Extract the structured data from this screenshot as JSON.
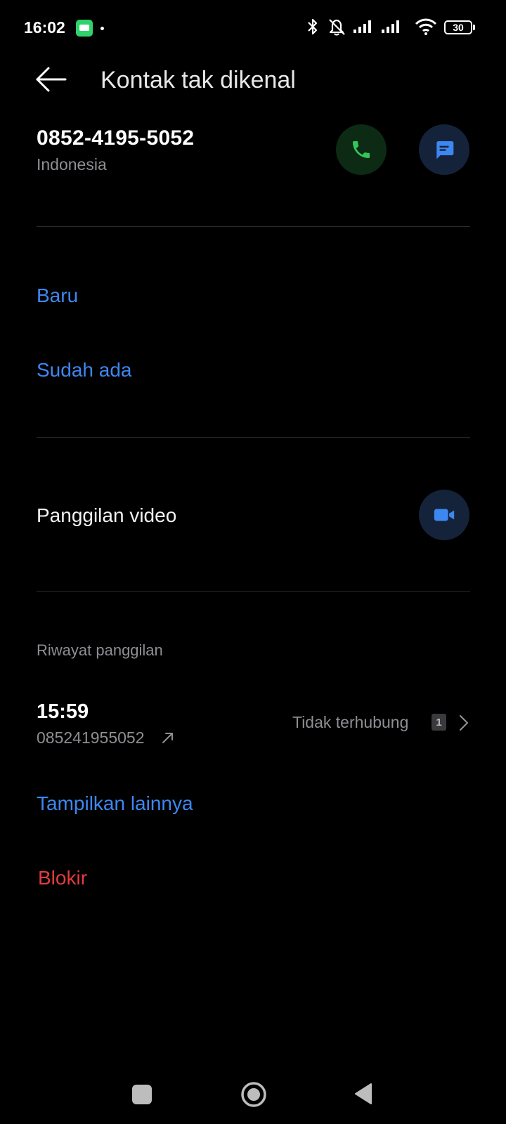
{
  "status_bar": {
    "time": "16:02",
    "app_icon": "webtoon-app-icon",
    "battery_level": "30",
    "icons": [
      "bluetooth-icon",
      "silent-bell-icon",
      "signal-icon",
      "signal-icon",
      "wifi-icon",
      "battery-icon"
    ]
  },
  "app_bar": {
    "back_icon": "arrow-left-icon",
    "title": "Kontak tak dikenal"
  },
  "contact": {
    "number": "0852-4195-5052",
    "region": "Indonesia",
    "call_icon": "phone-icon",
    "message_icon": "message-icon"
  },
  "add_contact": {
    "new_label": "Baru",
    "existing_label": "Sudah ada"
  },
  "video_call": {
    "label": "Panggilan video",
    "icon": "video-camera-icon"
  },
  "call_history": {
    "header": "Riwayat panggilan",
    "entries": [
      {
        "time": "15:59",
        "number": "085241955052",
        "direction_icon": "outgoing-arrow-icon",
        "status": "Tidak terhubung",
        "sim": "1"
      }
    ],
    "show_more_label": "Tampilkan lainnya"
  },
  "block_label": "Blokir",
  "nav_bar": {
    "icons": [
      "recents-square-icon",
      "home-circle-icon",
      "back-triangle-icon"
    ]
  },
  "colors": {
    "background": "#000000",
    "link_blue": "#3d87f0",
    "danger_red": "#e23c3c",
    "call_green": "#32c75a",
    "secondary_text": "#8e8e93"
  }
}
